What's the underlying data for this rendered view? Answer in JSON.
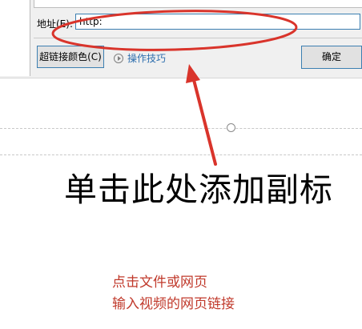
{
  "dialog": {
    "address_label": "地址(E):",
    "address_value": "http:",
    "hyperlink_color_button": "超链接颜色(C)",
    "tips_link": "操作技巧",
    "ok_button": "确定"
  },
  "slide": {
    "subtitle_placeholder": "单击此处添加副标"
  },
  "annotation": {
    "line1": "点击文件或网页",
    "line2": "输入视频的网页链接",
    "color": "#d9342b"
  }
}
